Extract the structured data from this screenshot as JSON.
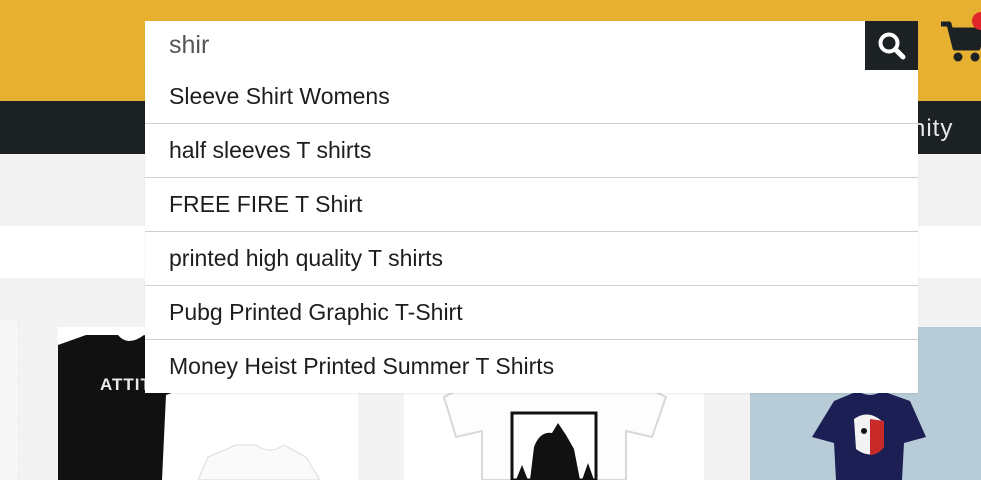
{
  "search": {
    "value": "shir",
    "suggestions": [
      "Sleeve Shirt Womens",
      "half sleeves T shirts",
      "FREE FIRE T Shirt",
      "printed high quality T shirts",
      "Pubg Printed Graphic T-Shirt",
      "Money Heist Printed Summer T Shirts"
    ]
  },
  "nav": {
    "partial_label": "nity"
  },
  "products": [
    {
      "image_text": "ATTIT"
    }
  ],
  "icons": {
    "search_button": "search-icon",
    "cart": "shopping-cart-icon"
  },
  "colors": {
    "header": "#e8b030",
    "nav": "#1c2224",
    "badge": "#e0262b"
  }
}
